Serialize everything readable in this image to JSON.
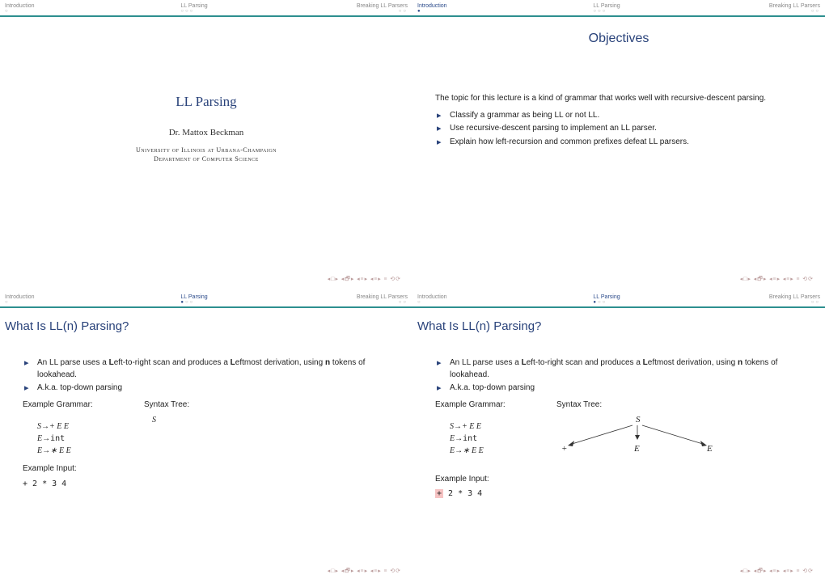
{
  "nav": {
    "sec1": "Introduction",
    "sec2": "LL Parsing",
    "sec3": "Breaking LL Parsers"
  },
  "slide1": {
    "title": "LL Parsing",
    "author": "Dr. Mattox Beckman",
    "affil1": "University of Illinois at Urbana-Champaign",
    "affil2": "Department of Computer Science"
  },
  "slide2": {
    "title": "Objectives",
    "intro": "The topic for this lecture is a kind of grammar that works well with recursive-descent parsing.",
    "b1": "Classify a grammar as being LL or not LL.",
    "b2": "Use recursive-descent parsing to implement an LL parser.",
    "b3": "Explain how left-recursion and common preﬁxes defeat LL parsers."
  },
  "slide3": {
    "title": "What Is LL(n) Parsing?",
    "b1a": "An LL parse uses a ",
    "b1b": "L",
    "b1c": "eft-to-right scan and produces a ",
    "b1d": "L",
    "b1e": "eftmost derivation, using ",
    "b1f": "n",
    "b1g": " tokens of lookahead.",
    "b2": "A.k.a. top-down parsing",
    "egram_label": "Example Grammar:",
    "stree_label": "Syntax Tree:",
    "g1a": "S→+ E E",
    "g2a": "E→",
    "g2b": "int",
    "g3a": "E→∗ E E",
    "einput_label": "Example Input:",
    "input": "+ 2 * 3 4",
    "tree_root": "S"
  },
  "slide4": {
    "title": "What Is LL(n) Parsing?",
    "input_hl": "+",
    "input_rest": " 2 * 3 4",
    "tree": {
      "S": "S",
      "plus": "+",
      "E1": "E",
      "E2": "E"
    }
  }
}
